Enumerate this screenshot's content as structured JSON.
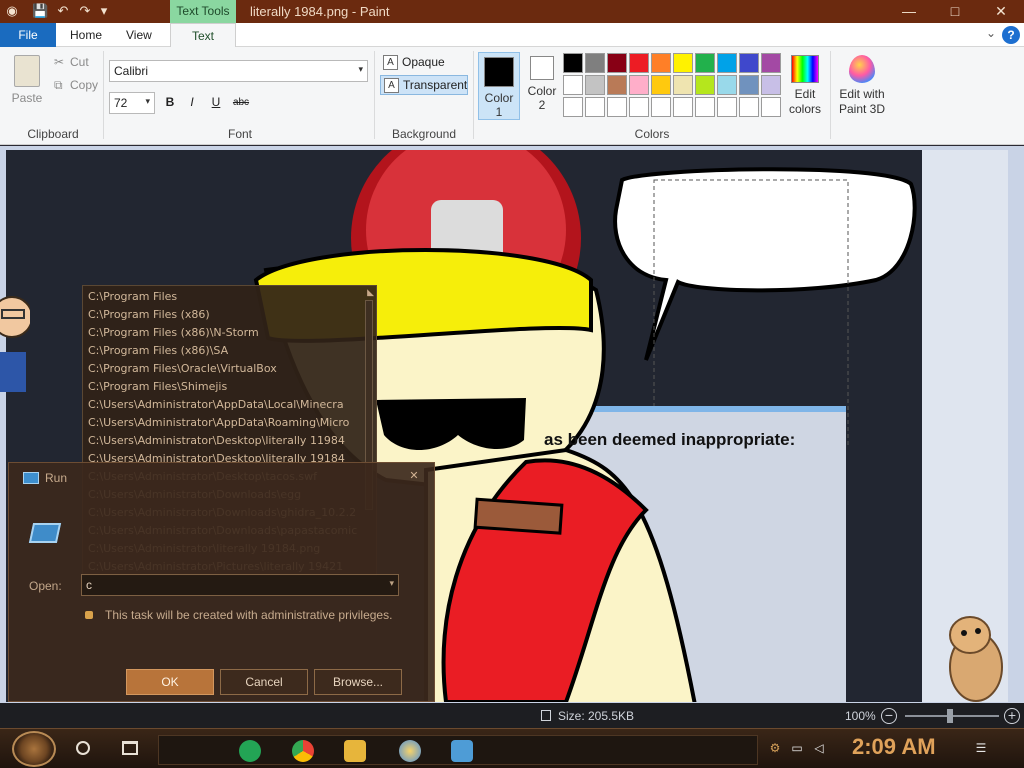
{
  "window": {
    "title": "literally 1984.png - Paint",
    "context_tab": "Text Tools",
    "minimize": "—",
    "maximize": "□",
    "close": "✕"
  },
  "quick_access": {
    "app_icon": "paint-app-icon",
    "save_icon": "💾",
    "undo_icon": "↶",
    "redo_icon": "↷",
    "customize_icon": "▾"
  },
  "tabs": {
    "file": "File",
    "home": "Home",
    "view": "View",
    "text": "Text",
    "help": "?",
    "collapse": "⌄"
  },
  "ribbon": {
    "clipboard": {
      "paste": "Paste",
      "cut": "Cut",
      "copy": "Copy",
      "label": "Clipboard"
    },
    "font": {
      "family": "Calibri",
      "size": "72",
      "bold": "B",
      "italic": "I",
      "underline": "U",
      "strike": "abc",
      "label": "Font"
    },
    "background": {
      "opaque": "Opaque",
      "transparent": "Transparent",
      "label": "Background"
    },
    "colors": {
      "color1_label": "Color",
      "color1_num": "1",
      "color2_label": "Color",
      "color2_num": "2",
      "color1": "#000000",
      "color2": "#ffffff",
      "palette_row1": [
        "#000000",
        "#7f7f7f",
        "#880015",
        "#ed1c24",
        "#ff7f27",
        "#fff200",
        "#22b14c",
        "#00a2e8",
        "#3f48cc",
        "#a349a4"
      ],
      "palette_row2": [
        "#ffffff",
        "#c3c3c3",
        "#b97a57",
        "#ffaec9",
        "#ffc90e",
        "#efe4b0",
        "#b5e61d",
        "#99d9ea",
        "#7092be",
        "#c8bfe7"
      ],
      "edit_colors_line1": "Edit",
      "edit_colors_line2": "colors",
      "label": "Colors"
    },
    "paint3d": {
      "line1": "Edit with",
      "line2": "Paint 3D"
    }
  },
  "canvas": {
    "caption": "as been deemed inappropriate:"
  },
  "autocomplete": {
    "items": [
      "C:\\Program Files",
      "C:\\Program Files (x86)",
      "C:\\Program Files (x86)\\N-Storm",
      "C:\\Program Files (x86)\\SA",
      "C:\\Program Files\\Oracle\\VirtualBox",
      "C:\\Program Files\\Shimejis",
      "C:\\Users\\Administrator\\AppData\\Local\\Minecra",
      "C:\\Users\\Administrator\\AppData\\Roaming\\Micro",
      "C:\\Users\\Administrator\\Desktop\\literally 11984",
      "C:\\Users\\Administrator\\Desktop\\literally 19184",
      "C:\\Users\\Administrator\\Desktop\\tacos.swf",
      "C:\\Users\\Administrator\\Downloads\\egg",
      "C:\\Users\\Administrator\\Downloads\\ghidra_10.2.2",
      "C:\\Users\\Administrator\\Downloads\\papastacomic",
      "C:\\Users\\Administrator\\literally 19184.png",
      "C:\\Users\\Administrator\\Pictures\\literally 19421"
    ]
  },
  "run_dialog": {
    "title": "Run",
    "open_label": "Open:",
    "open_value": "c",
    "admin_note": "This task will be created with administrative privileges.",
    "ok": "OK",
    "cancel": "Cancel",
    "browse": "Browse..."
  },
  "statusbar": {
    "size": "Size: 205.5KB",
    "zoom": "100%",
    "minus": "−",
    "plus": "+"
  },
  "taskbar": {
    "clock": "2:09 AM"
  }
}
